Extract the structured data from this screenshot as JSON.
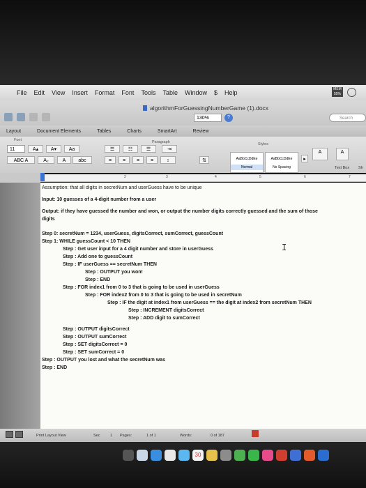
{
  "menubar": {
    "items": [
      "File",
      "Edit",
      "View",
      "Insert",
      "Format",
      "Font",
      "Tools",
      "Table",
      "Window",
      "Help"
    ],
    "mem_label": "MEM",
    "mem_value": "55%"
  },
  "window": {
    "title": "algorithmForGuessingNumberGame (1).docx",
    "zoom": "130%",
    "search_placeholder": "Search"
  },
  "ribbon": {
    "tabs": [
      "Layout",
      "Document Elements",
      "Tables",
      "Charts",
      "SmartArt",
      "Review"
    ],
    "group_font": "Font",
    "group_paragraph": "Paragraph",
    "group_styles": "Styles",
    "font_size": "11",
    "styles": [
      {
        "sample": "AaBbCcDdEe",
        "name": "Normal"
      },
      {
        "sample": "AaBbCcDdEe",
        "name": "No Spacing"
      }
    ],
    "text_box_label": "Text Box",
    "shape_label": "Sh"
  },
  "ruler": {
    "numbers": [
      "1",
      "2",
      "3",
      "4",
      "5",
      "6",
      "7"
    ]
  },
  "document": {
    "lines": [
      {
        "text": "Assumption: that all digits in secretNum and userGuess have to be unique",
        "bold": false
      },
      {
        "text": "Input: 10 guesses of a 4-digit number from a user",
        "bold": true
      },
      {
        "text": "Output: if they have guessed the number and won, or output the number digits correctly guessed and the sum of those",
        "bold": true
      },
      {
        "text": "digits",
        "bold": true
      },
      {
        "text": "Step 0: secretNum = 1234, userGuess, digitsCorrect, sumCorrect, guessCount",
        "bold": true
      },
      {
        "text": "Step 1: WHILE guessCount < 10 THEN",
        "bold": true
      },
      {
        "text": "Step : Get user input for a 4 digit number and store in userGuess",
        "bold": true
      },
      {
        "text": "Step : Add one to guessCount",
        "bold": true
      },
      {
        "text": "Step : IF userGuess == secretNum THEN",
        "bold": true
      },
      {
        "text": "Step : OUTPUT you won!",
        "bold": true
      },
      {
        "text": "Step : END",
        "bold": true
      },
      {
        "text": "Step : FOR index1 from 0 to 3 that is going to be used in userGuess",
        "bold": true
      },
      {
        "text": "Step : FOR index2 from 0 to 3 that is going to be used in secretNum",
        "bold": true
      },
      {
        "text": "Step : IF the digit at index1 from userGuess == the digit at index2 from secretNum THEN",
        "bold": true
      },
      {
        "text": "Step : INCREMENT digitsCorrect",
        "bold": true
      },
      {
        "text": "Step : ADD digit to sumCorrect",
        "bold": true
      },
      {
        "text": "Step : OUTPUT digitsCorrect",
        "bold": true
      },
      {
        "text": "Step : OUTPUT sumCorrect",
        "bold": true
      },
      {
        "text": "Step : SET digitsCorrect = 0",
        "bold": true
      },
      {
        "text": "Step : SET sumCorrect = 0",
        "bold": true
      },
      {
        "text": "Step : OUTPUT you lost and what the secretNum was",
        "bold": true
      },
      {
        "text": "Step : END",
        "bold": true
      }
    ]
  },
  "statusbar": {
    "view": "Print Layout View",
    "sec_label": "Sec",
    "sec_value": "1",
    "pages_label": "Pages:",
    "pages_value": "1 of 1",
    "words_label": "Words:",
    "words_value": "0 of 187"
  },
  "dock": {
    "calendar_day": "30"
  },
  "colors": {
    "accent": "#3b73d4",
    "page": "#fbfbf8"
  }
}
